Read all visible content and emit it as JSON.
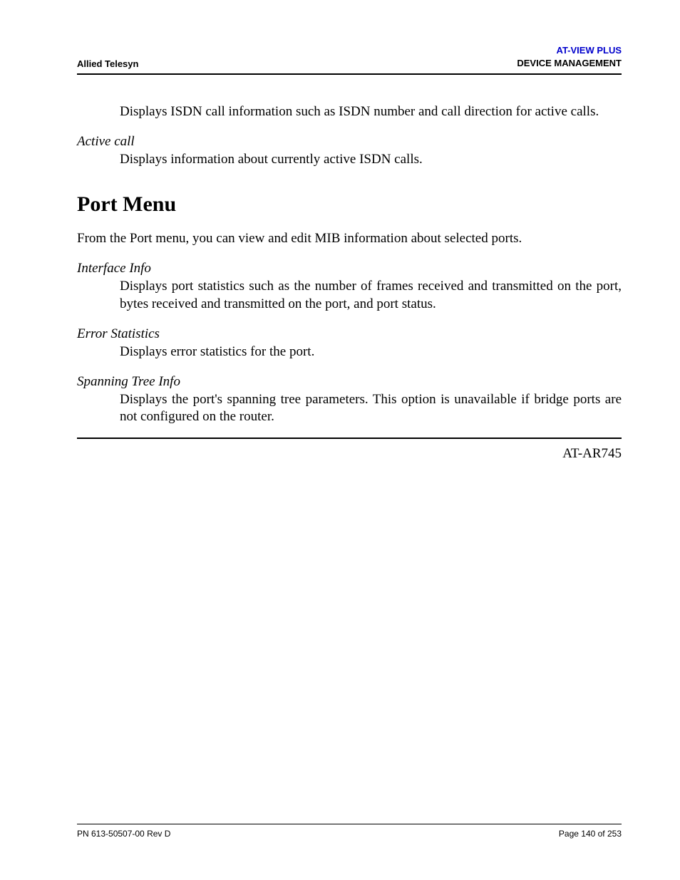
{
  "header": {
    "left": "Allied Telesyn",
    "right_top": "AT-VIEW PLUS",
    "right_bottom": "DEVICE MANAGEMENT"
  },
  "content": {
    "intro_paragraph": "Displays ISDN call information such as ISDN number and call direction for active calls.",
    "terms_top": [
      {
        "term": "Active call",
        "desc": "Displays information about currently active ISDN calls."
      }
    ],
    "section_heading": "Port Menu",
    "section_intro": "From the Port menu, you can view and edit MIB information about selected ports.",
    "terms_bottom": [
      {
        "term": "Interface Info",
        "desc": "Displays port statistics such as the number of frames received and transmitted on the port, bytes received and transmitted on the port, and port status."
      },
      {
        "term": "Error Statistics",
        "desc": "Displays error statistics for the port."
      },
      {
        "term": "Spanning Tree Info",
        "desc": "Displays the port's spanning tree parameters. This option is unavailable if bridge ports are not configured on the router."
      }
    ],
    "model": "AT-AR745"
  },
  "footer": {
    "left": "PN 613-50507-00 Rev D",
    "right": "Page 140 of 253"
  }
}
